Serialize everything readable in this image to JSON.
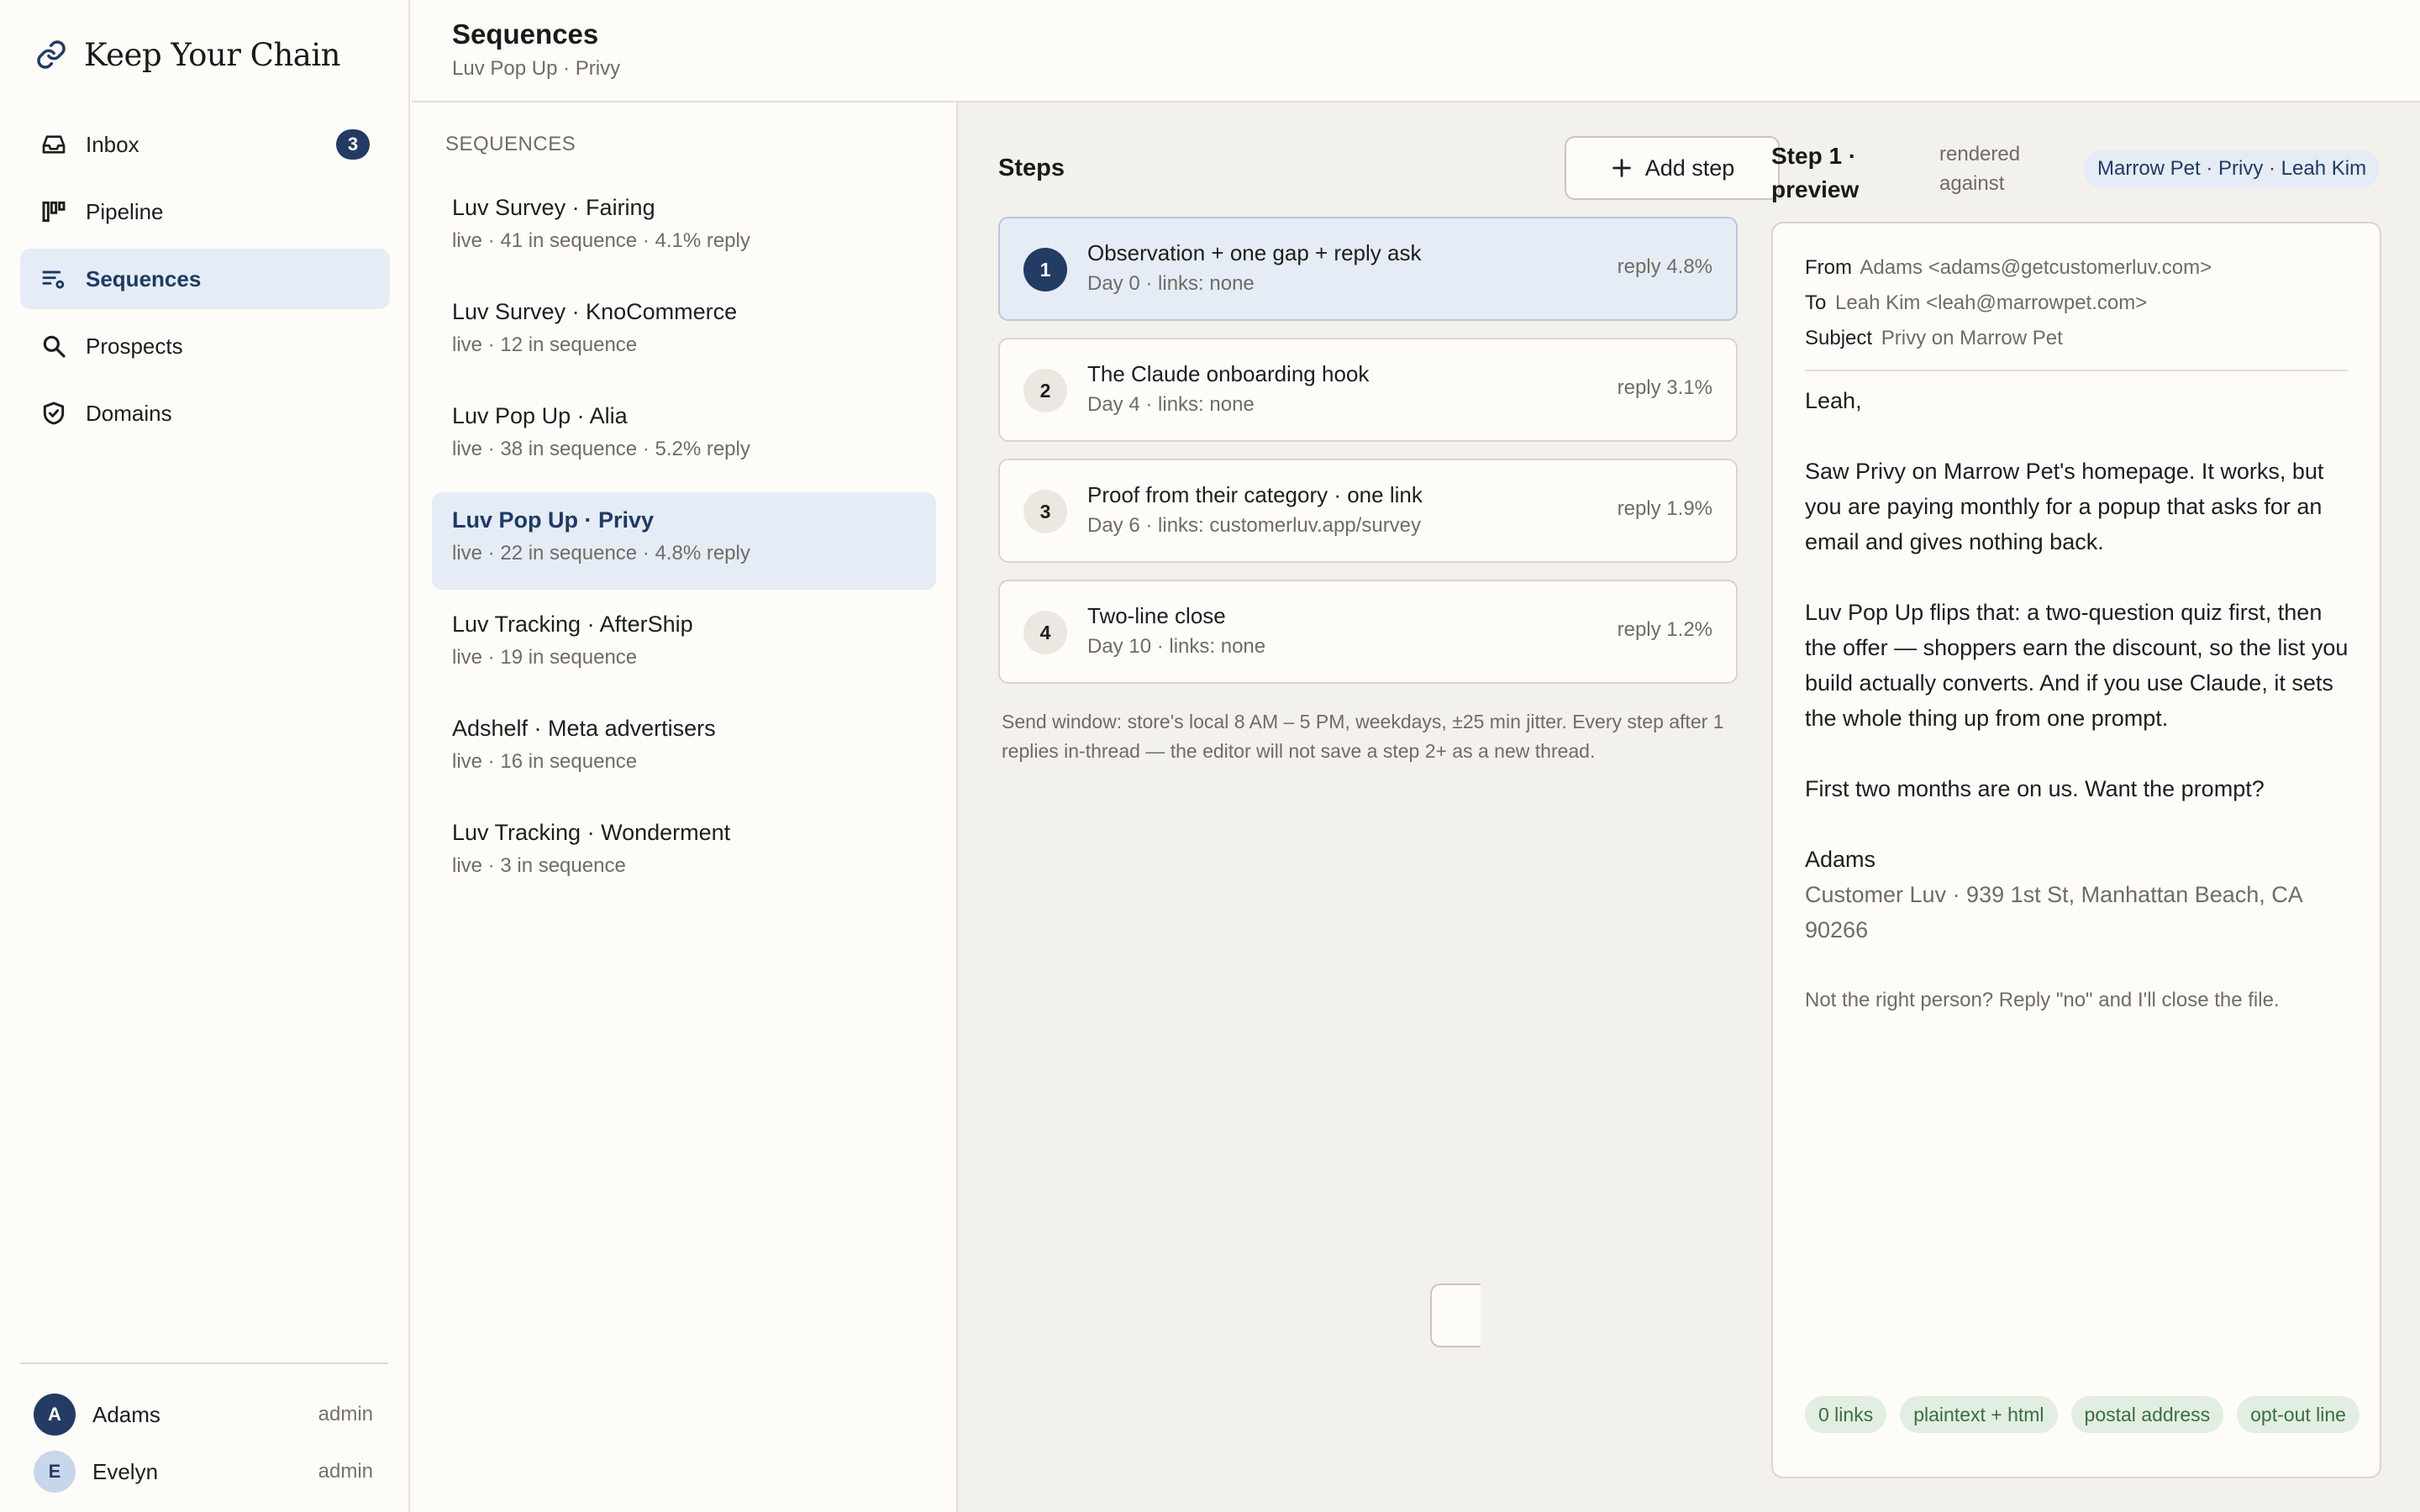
{
  "brand": {
    "name": "Keep Your Chain",
    "icon": "chain-link-icon"
  },
  "nav": [
    {
      "label": "Inbox",
      "icon": "inbox-icon",
      "badge": "3",
      "active": false
    },
    {
      "label": "Pipeline",
      "icon": "pipeline-icon",
      "active": false
    },
    {
      "label": "Sequences",
      "icon": "sequences-icon",
      "active": true
    },
    {
      "label": "Prospects",
      "icon": "search-icon",
      "active": false
    },
    {
      "label": "Domains",
      "icon": "shield-check-icon",
      "active": false
    }
  ],
  "users": [
    {
      "initial": "A",
      "name": "Adams",
      "role": "admin"
    },
    {
      "initial": "E",
      "name": "Evelyn",
      "role": "admin"
    }
  ],
  "header": {
    "title": "Sequences",
    "subtitle": "Luv Pop Up · Privy"
  },
  "sequences": {
    "label": "SEQUENCES",
    "items": [
      {
        "name": "Luv Survey · Fairing",
        "meta": "live · 41 in sequence · 4.1% reply",
        "active": false
      },
      {
        "name": "Luv Survey · KnoCommerce",
        "meta": "live · 12 in sequence",
        "active": false
      },
      {
        "name": "Luv Pop Up · Alia",
        "meta": "live · 38 in sequence · 5.2% reply",
        "active": false
      },
      {
        "name": "Luv Pop Up · Privy",
        "meta": "live · 22 in sequence · 4.8% reply",
        "active": true
      },
      {
        "name": "Luv Tracking · AfterShip",
        "meta": "live · 19 in sequence",
        "active": false
      },
      {
        "name": "Adshelf · Meta advertisers",
        "meta": "live · 16 in sequence",
        "active": false
      },
      {
        "name": "Luv Tracking · Wonderment",
        "meta": "live · 3 in sequence",
        "active": false
      }
    ]
  },
  "steps": {
    "title": "Steps",
    "add_label": "Add step",
    "items": [
      {
        "num": "1",
        "title": "Observation + one gap + reply ask",
        "meta": "Day 0 · links: none",
        "reply": "reply 4.8%",
        "active": true
      },
      {
        "num": "2",
        "title": "The Claude onboarding hook",
        "meta": "Day 4 · links: none",
        "reply": "reply 3.1%",
        "active": false
      },
      {
        "num": "3",
        "title": "Proof from their category · one link",
        "meta": "Day 6 · links: customerluv.app/survey",
        "reply": "reply 1.9%",
        "active": false
      },
      {
        "num": "4",
        "title": "Two-line close",
        "meta": "Day 10 · links: none",
        "reply": "reply 1.2%",
        "active": false
      }
    ],
    "note": "Send window: store's local 8 AM – 5 PM, weekdays, ±25 min jitter. Every step after 1 replies in-thread — the editor will not save a step 2+ as a new thread."
  },
  "preview": {
    "title": "Step 1 · preview",
    "against_label": "rendered against",
    "against_value": "Marrow Pet · Privy · Leah Kim",
    "from_key": "From",
    "from": "Adams <adams@getcustomerluv.com>",
    "to_key": "To",
    "to": "Leah Kim <leah@marrowpet.com>",
    "subject_key": "Subject",
    "subject": "Privy on Marrow Pet",
    "greeting": "Leah,",
    "para1": "Saw Privy on Marrow Pet's homepage. It works, but you are paying monthly for a popup that asks for an email and gives nothing back.",
    "para2": "Luv Pop Up flips that: a two-question quiz first, then the offer — shoppers earn the discount, so the list you build actually converts. And if you use Claude, it sets the whole thing up from one prompt.",
    "para3": "First two months are on us. Want the prompt?",
    "sig_name": "Adams",
    "sig_address": "Customer Luv · 939 1st St, Manhattan Beach, CA 90266",
    "optout": "Not the right person? Reply \"no\" and I'll close the file.",
    "checks": [
      "0 links",
      "plaintext + html",
      "postal address",
      "opt-out line"
    ]
  },
  "colors": {
    "accent": "#243b64",
    "active_bg": "#e5ecf5",
    "check_bg": "#e3eee2",
    "check_text": "#3a6e3f"
  }
}
